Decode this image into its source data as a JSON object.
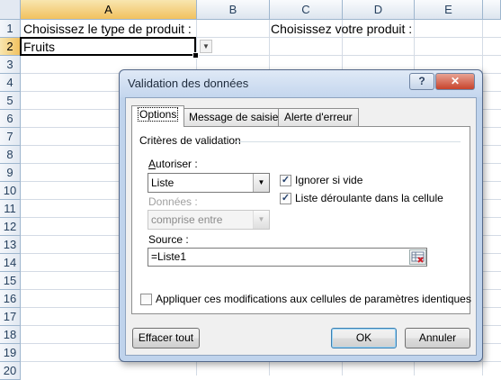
{
  "sheet": {
    "columns": [
      "A",
      "B",
      "C",
      "D",
      "E"
    ],
    "rows": [
      "1",
      "2",
      "3",
      "4",
      "5",
      "6",
      "7",
      "8",
      "9",
      "10",
      "11",
      "12",
      "13",
      "14",
      "15",
      "16",
      "17",
      "18",
      "19",
      "20"
    ],
    "a1": "Choisissez le type de produit :",
    "a2": "Fruits",
    "c1": "Choisissez votre produit :"
  },
  "dialog": {
    "title": "Validation des données",
    "help": "?",
    "close": "✕",
    "tabs": [
      "Options",
      "Message de saisie",
      "Alerte d'erreur"
    ],
    "group_title": "Critères de validation",
    "allow_label": "Autoriser :",
    "allow_value": "Liste",
    "data_label": "Données :",
    "data_value": "comprise entre",
    "ignore_blank": "Ignorer si vide",
    "in_cell_dropdown": "Liste déroulante dans la cellule",
    "source_label": "Source :",
    "source_value": "=Liste1",
    "apply_all": "Appliquer ces modifications aux cellules de paramètres identiques",
    "clear_all": "Effacer tout",
    "ok": "OK",
    "cancel": "Annuler"
  },
  "colors": {
    "header_selected": "#f1c15f",
    "grid": "#d4dbe5",
    "dialog_frame": "#bfd3ec"
  }
}
